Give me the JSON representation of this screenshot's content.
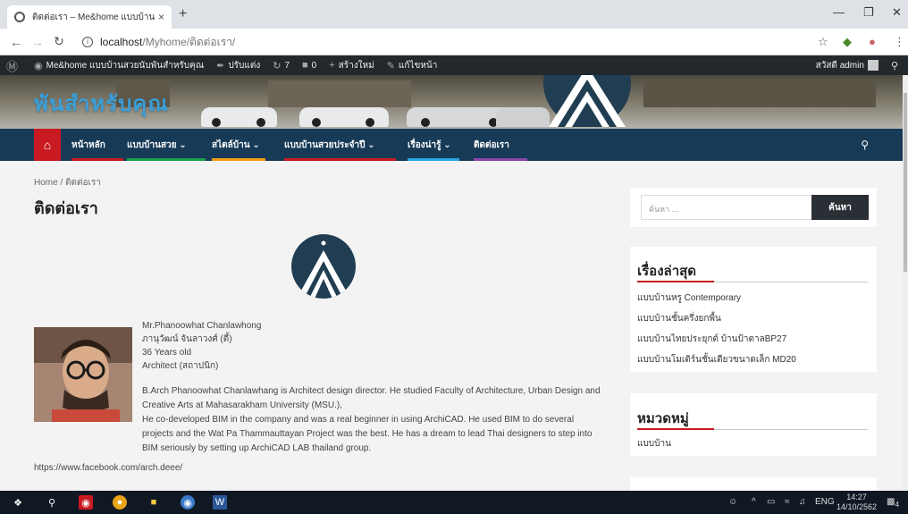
{
  "browser": {
    "tab_title": "ติดต่อเรา – Me&home แบบบ้านสวยนับพันสำหรับคุณ",
    "tab_close": "×",
    "new_tab": "+",
    "url_host": "localhost",
    "url_path": "/Myhome/ติดต่อเรา/"
  },
  "adminbar": {
    "site_name": "Me&home แบบบ้านสวยนับพันสำหรับคุณ",
    "customize": "ปรับแต่ง",
    "updates": "7",
    "comments": "0",
    "new": "สร้างใหม่",
    "edit_page": "แก้ไขหน้า",
    "greeting": "สวัสดี admin"
  },
  "header": {
    "site_title": "พันสำหรับคุณ"
  },
  "nav": {
    "items": [
      {
        "label": "หน้าหลัก",
        "color": "#c91a22"
      },
      {
        "label": "แบบบ้านสวย ⌄",
        "color": "#1aa34a"
      },
      {
        "label": "สไตล์บ้าน ⌄",
        "color": "#f39c12"
      },
      {
        "label": "แบบบ้านสวยประจำปี ⌄",
        "color": "#c91a22"
      },
      {
        "label": "เรื่องน่ารู้ ⌄",
        "color": "#29a8e0"
      },
      {
        "label": "ติดต่อเรา",
        "color": "#8e44ad"
      }
    ]
  },
  "page": {
    "breadcrumb_home": "Home",
    "breadcrumb_sep": "/",
    "breadcrumb_current": "ติดต่อเรา",
    "title": "ติดต่อเรา",
    "bio_lines": [
      "Mr.Phanoowhat Chanlawhong",
      "ภานุวัฒน์ จันลาวงศ์ (ดี้)",
      "36 Years old",
      "Architect (สถาปนิก)"
    ],
    "bio_paragraph": [
      "B.Arch Phanoowhat Chanlawhang is Architect design director. He studied Faculty of Architecture, Urban Design and",
      "Creative Arts at Mahasarakham University (MSU.),",
      "He co-developed BIM in the company and was a real beginner in using ArchiCAD. He used BIM to do several",
      "projects and the Wat Pa Thammauttayan Project was the best. He has a dream to lead Thai designers to step into",
      "BIM seriously by setting up ArchiCAD LAB thailand group."
    ],
    "facebook_link": "https://www.facebook.com/arch.deee/"
  },
  "sidebar": {
    "search_placeholder": "ค้นหา ...",
    "search_button": "ค้นหา",
    "recent_title": "เรื่องล่าสุด",
    "recent_posts": [
      "แบบบ้านหรู Contemporary",
      "แบบบ้านชั้นครึ่งยกพื้น",
      "แบบบ้านไทยประยุกต์ บ้านป้าตาลBP27",
      "แบบบ้านโมเดิร์นชั้นเดียวขนาดเล็ก MD20"
    ],
    "categories_title": "หมวดหมู่",
    "categories": [
      "แบบบ้าน"
    ]
  },
  "taskbar": {
    "language": "ENG",
    "time": "14:27",
    "date": "14/10/2562",
    "notifications": "4"
  }
}
